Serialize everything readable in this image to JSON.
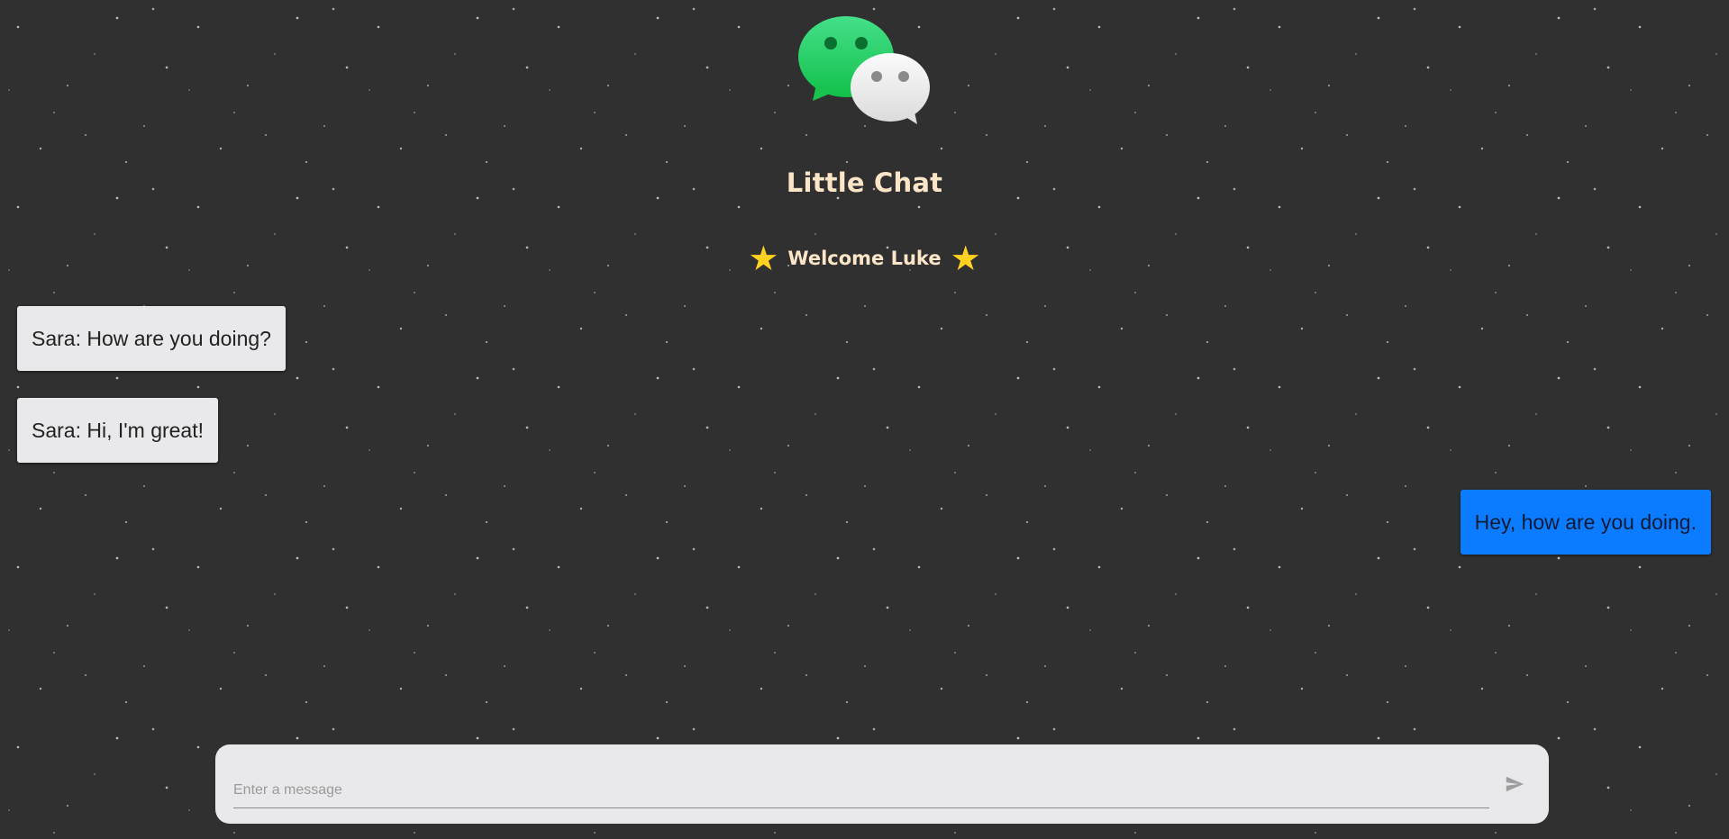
{
  "header": {
    "title": "Little Chat",
    "welcome": "Welcome Luke",
    "logo_icon": "chat-bubbles-icon",
    "star_icon": "star-icon",
    "star_color": "#ffd21f"
  },
  "messages": [
    {
      "direction": "incoming",
      "text": "Sara: How are you doing?"
    },
    {
      "direction": "incoming",
      "text": "Sara: Hi, I'm great!"
    },
    {
      "direction": "outgoing",
      "text": "Hey, how are you doing."
    }
  ],
  "composer": {
    "placeholder": "Enter a message",
    "value": "",
    "send_icon": "send-icon"
  },
  "colors": {
    "background": "#303030",
    "title_text": "#fde6c8",
    "incoming_bubble": "#e9e9eb",
    "outgoing_bubble": "#0b7cff",
    "logo_green": "#2ccf5f",
    "logo_white": "#eeeeee"
  }
}
